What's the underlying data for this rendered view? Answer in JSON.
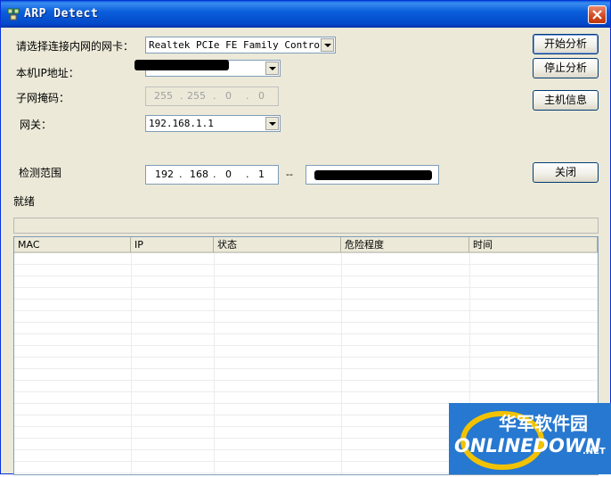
{
  "window": {
    "title": "ARP Detect"
  },
  "form": {
    "nic_label": "请选择连接内网的网卡：",
    "nic_value": "Realtek PCIe FE Family Controlle",
    "local_ip_label": "本机IP地址：",
    "subnet_label": "子网掩码：",
    "subnet_octets": [
      "255",
      "255",
      "0",
      "0"
    ],
    "gateway_label": "网关：",
    "gateway_value": "192.168.1.1",
    "range_label": "检测范围",
    "range_start_octets": [
      "192",
      "168",
      "0",
      "1"
    ],
    "range_separator": "--"
  },
  "buttons": {
    "start": "开始分析",
    "stop": "停止分析",
    "host_info": "主机信息",
    "close": "关闭"
  },
  "status": {
    "text": "就绪"
  },
  "table": {
    "columns": [
      "MAC",
      "IP",
      "状态",
      "危险程度",
      "时间"
    ]
  },
  "watermark": {
    "cn": "华军软件园",
    "en": "ONLINEDOWN",
    "suffix": ".NET"
  }
}
